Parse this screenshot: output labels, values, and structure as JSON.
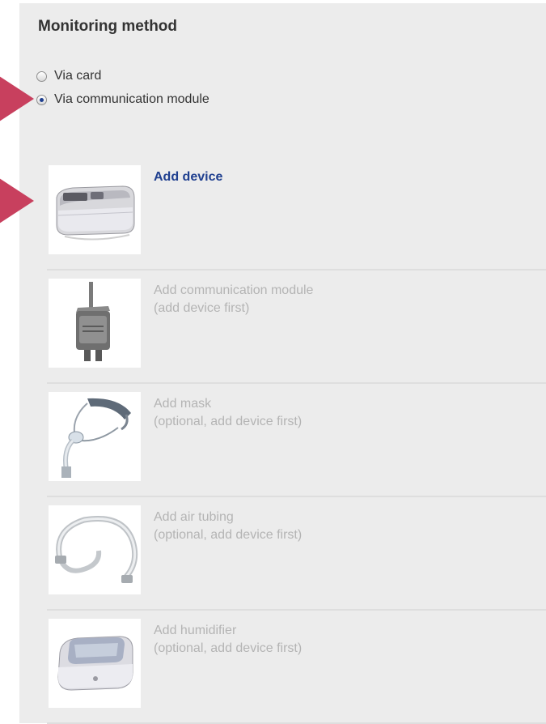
{
  "monitoring": {
    "title": "Monitoring method",
    "options": [
      {
        "label": "Via card",
        "selected": false
      },
      {
        "label": "Via communication module",
        "selected": true
      }
    ]
  },
  "items": [
    {
      "title": "Add device",
      "note": "",
      "enabled": true,
      "icon": "cpap-device-image"
    },
    {
      "title": "Add communication module",
      "note": "(add device first)",
      "enabled": false,
      "icon": "communication-module-image"
    },
    {
      "title": "Add mask",
      "note": "(optional, add device first)",
      "enabled": false,
      "icon": "mask-image"
    },
    {
      "title": "Add air tubing",
      "note": "(optional, add device first)",
      "enabled": false,
      "icon": "air-tubing-image"
    },
    {
      "title": "Add humidifier",
      "note": "(optional, add device first)",
      "enabled": false,
      "icon": "humidifier-image"
    }
  ],
  "colors": {
    "accent": "#1f3f8f",
    "disabled_text": "#b4b4b4",
    "callout_arrow": "#c8405e",
    "panel_background": "#ececec"
  }
}
